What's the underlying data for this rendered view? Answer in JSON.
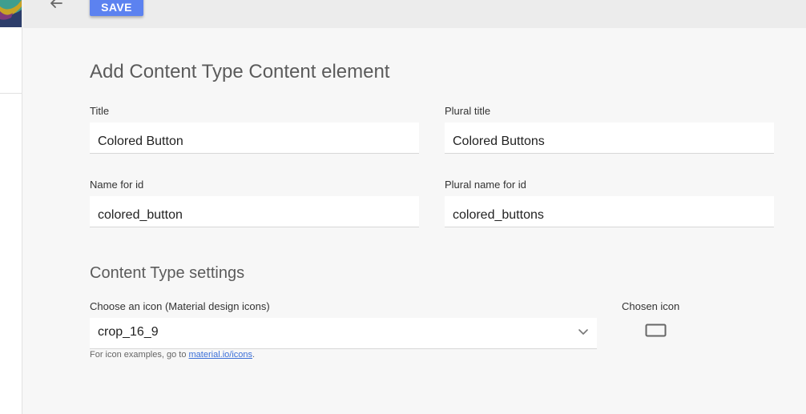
{
  "toolbar": {
    "save_label": "SAVE",
    "back_icon": "arrow-back-icon"
  },
  "form": {
    "heading": "Add Content Type Content element",
    "title": {
      "label": "Title",
      "value": "Colored Button"
    },
    "plural_title": {
      "label": "Plural title",
      "value": "Colored Buttons"
    },
    "name_id": {
      "label": "Name for id",
      "value": "colored_button"
    },
    "plural_name_id": {
      "label": "Plural name for id",
      "value": "colored_buttons"
    }
  },
  "settings": {
    "heading": "Content Type settings",
    "icon_select": {
      "label": "Choose an icon (Material design icons)",
      "value": "crop_16_9"
    },
    "hint_prefix": "For icon examples, go to ",
    "hint_link": "material.io/icons",
    "hint_suffix": ".",
    "chosen_label": "Chosen icon",
    "chosen_icon": "crop-16-9-icon"
  },
  "colors": {
    "accent": "#5c82f0",
    "link": "#3b6fd8",
    "background": "#f7f7f7"
  }
}
